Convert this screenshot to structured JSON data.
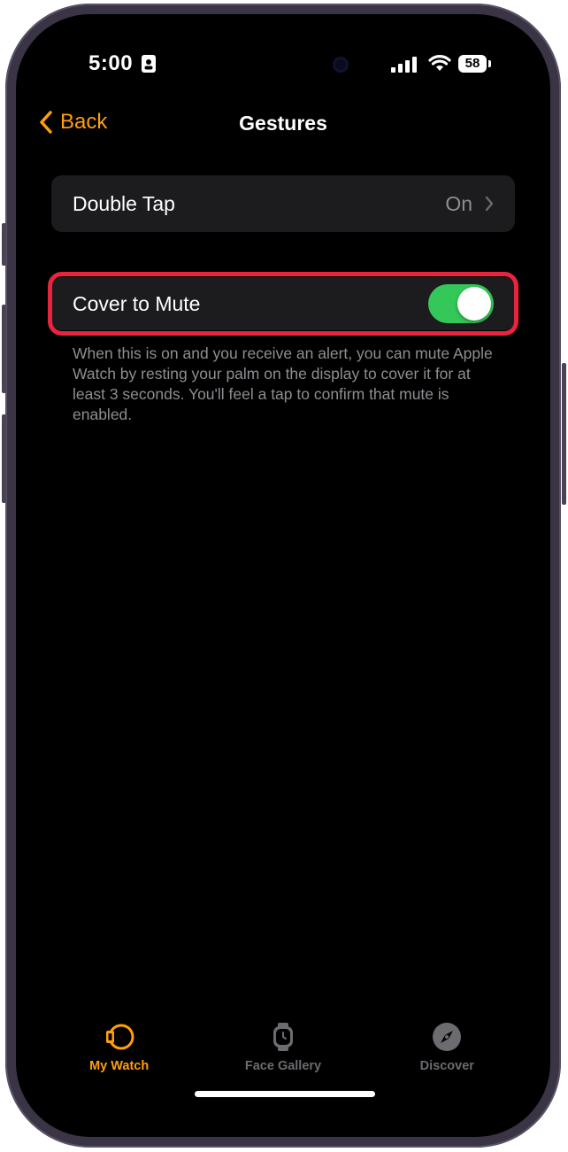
{
  "status_bar": {
    "time": "5:00",
    "battery": "58"
  },
  "nav": {
    "back_label": "Back",
    "title": "Gestures"
  },
  "double_tap": {
    "label": "Double Tap",
    "value": "On"
  },
  "cover_to_mute": {
    "label": "Cover to Mute",
    "enabled": true,
    "description": "When this is on and you receive an alert, you can mute Apple Watch by resting your palm on the display to cover it for at least 3 seconds. You'll feel a tap to confirm that mute is enabled."
  },
  "tabs": [
    {
      "label": "My Watch",
      "icon": "watch-orange-icon",
      "active": true
    },
    {
      "label": "Face Gallery",
      "icon": "watch-face-icon",
      "active": false
    },
    {
      "label": "Discover",
      "icon": "compass-icon",
      "active": false
    }
  ],
  "colors": {
    "accent": "#ff9f0a",
    "toggle_on": "#34c759",
    "highlight": "#e8243f",
    "row_bg": "#1c1c1e"
  }
}
